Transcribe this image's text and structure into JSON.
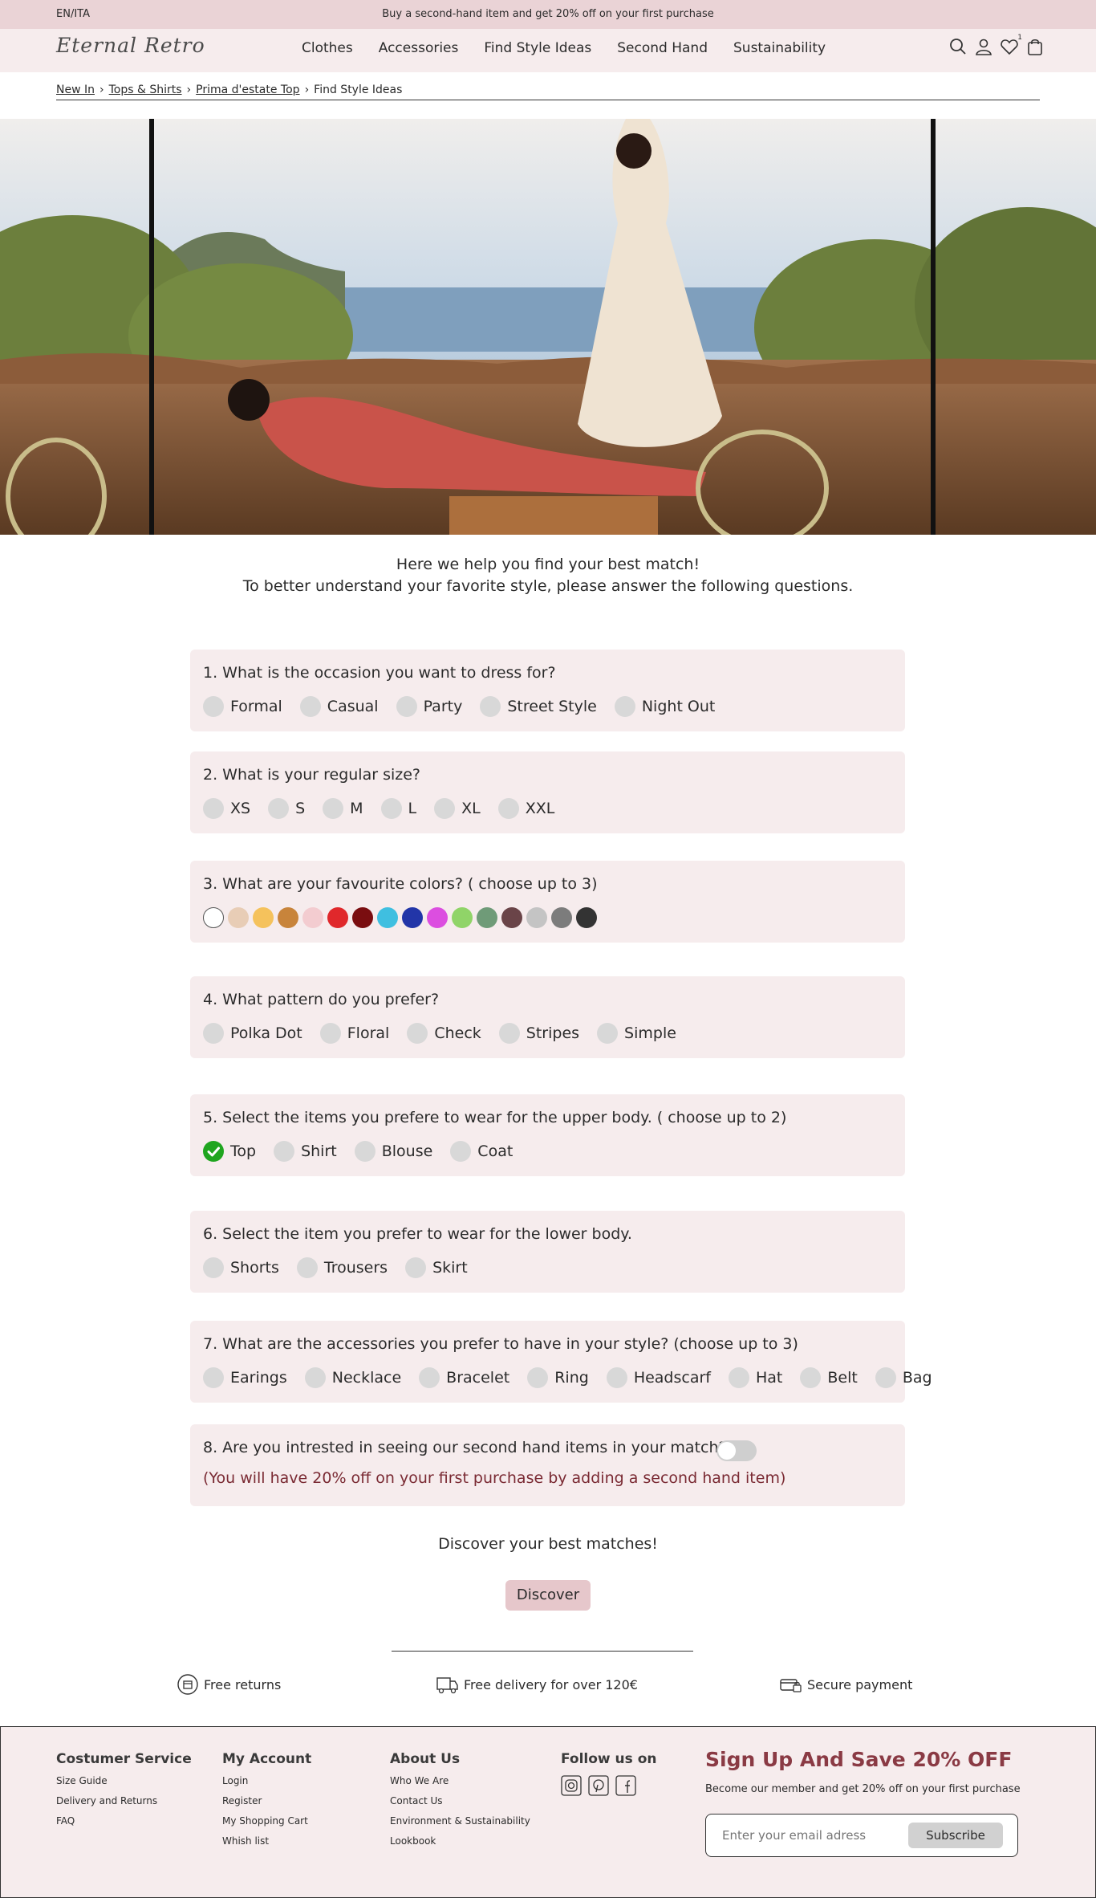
{
  "promo": {
    "lang": "EN/ITA",
    "message": "Buy a second-hand item and get 20% off on your first purchase"
  },
  "header": {
    "logo": "Eternal Retro",
    "nav": [
      "Clothes",
      "Accessories",
      "Find Style Ideas",
      "Second Hand",
      "Sustainability"
    ],
    "wishlist_count": "1",
    "icons": [
      "search-icon",
      "user-icon",
      "heart-icon",
      "bag-icon"
    ]
  },
  "breadcrumb": [
    "New In",
    "Tops & Shirts",
    "Prima d'estate Top",
    "Find Style Ideas"
  ],
  "intro": {
    "line1": "Here we help you find your best match!",
    "line2": "To better understand your favorite style,  please answer the following questions."
  },
  "questions": {
    "q1": {
      "text": "1. What is the occasion you want to dress for?",
      "options": [
        "Formal",
        "Casual",
        "Party",
        "Street Style",
        "Night Out"
      ]
    },
    "q2": {
      "text": "2. What is your regular size?",
      "options": [
        "XS",
        "S",
        "M",
        "L",
        "XL",
        "XXL"
      ]
    },
    "q3": {
      "text": "3. What are your favourite colors? ( choose up to 3)",
      "colors": [
        "#ffffff",
        "#e8cdb6",
        "#f5c25c",
        "#c8843b",
        "#f3ccd0",
        "#e0282b",
        "#7a0d10",
        "#3fbfe0",
        "#2235a8",
        "#dc4ee0",
        "#90d468",
        "#6f9b78",
        "#6a4448",
        "#c4c4c4",
        "#7c7c7c",
        "#333333"
      ]
    },
    "q4": {
      "text": "4. What pattern do you prefer?",
      "options": [
        "Polka Dot",
        "Floral",
        "Check",
        "Stripes",
        "Simple"
      ]
    },
    "q5": {
      "text": "5. Select the items you prefere to wear for the upper body. ( choose up to 2)",
      "options": [
        "Top",
        "Shirt",
        "Blouse",
        "Coat"
      ],
      "selected": "Top"
    },
    "q6": {
      "text": "6. Select the item you prefer to wear for the lower body.",
      "options": [
        "Shorts",
        "Trousers",
        "Skirt"
      ]
    },
    "q7": {
      "text": "7. What are the accessories you prefer to have in your style? (choose up to 3)",
      "options": [
        "Earings",
        "Necklace",
        "Bracelet",
        "Ring",
        "Headscarf",
        "Hat",
        "Belt",
        "Bag"
      ]
    },
    "q8": {
      "text": "8. Are you intrested in seeing our second hand items in your match?",
      "note": "(You will have 20% off on your first purchase by adding a second hand item)",
      "toggle": "off"
    }
  },
  "discover": {
    "title": "Discover your best matches!",
    "button": "Discover"
  },
  "perks": [
    "Free returns",
    "Free delivery for over 120€",
    "Secure payment"
  ],
  "footer": {
    "service": {
      "title": "Costumer Service",
      "links": [
        "Size Guide",
        "Delivery and Returns",
        "FAQ"
      ]
    },
    "account": {
      "title": "My Account",
      "links": [
        "Login",
        "Register",
        "My Shopping Cart",
        "Whish list"
      ]
    },
    "about": {
      "title": "About Us",
      "links": [
        "Who We Are",
        "Contact Us",
        "Environment & Sustainability",
        "Lookbook"
      ]
    },
    "follow": {
      "title": "Follow us on",
      "icons": [
        "instagram-icon",
        "pinterest-icon",
        "facebook-icon"
      ]
    },
    "signup": {
      "title": "Sign Up And Save 20% OFF",
      "subtitle": "Become our member and get 20% off on your first purchase",
      "placeholder": "Enter your email adress",
      "button": "Subscribe"
    }
  },
  "colors": {
    "accent": "#ead3d6",
    "card": "#f6eced",
    "note": "#7a2a33",
    "check": "#1fa51f"
  }
}
